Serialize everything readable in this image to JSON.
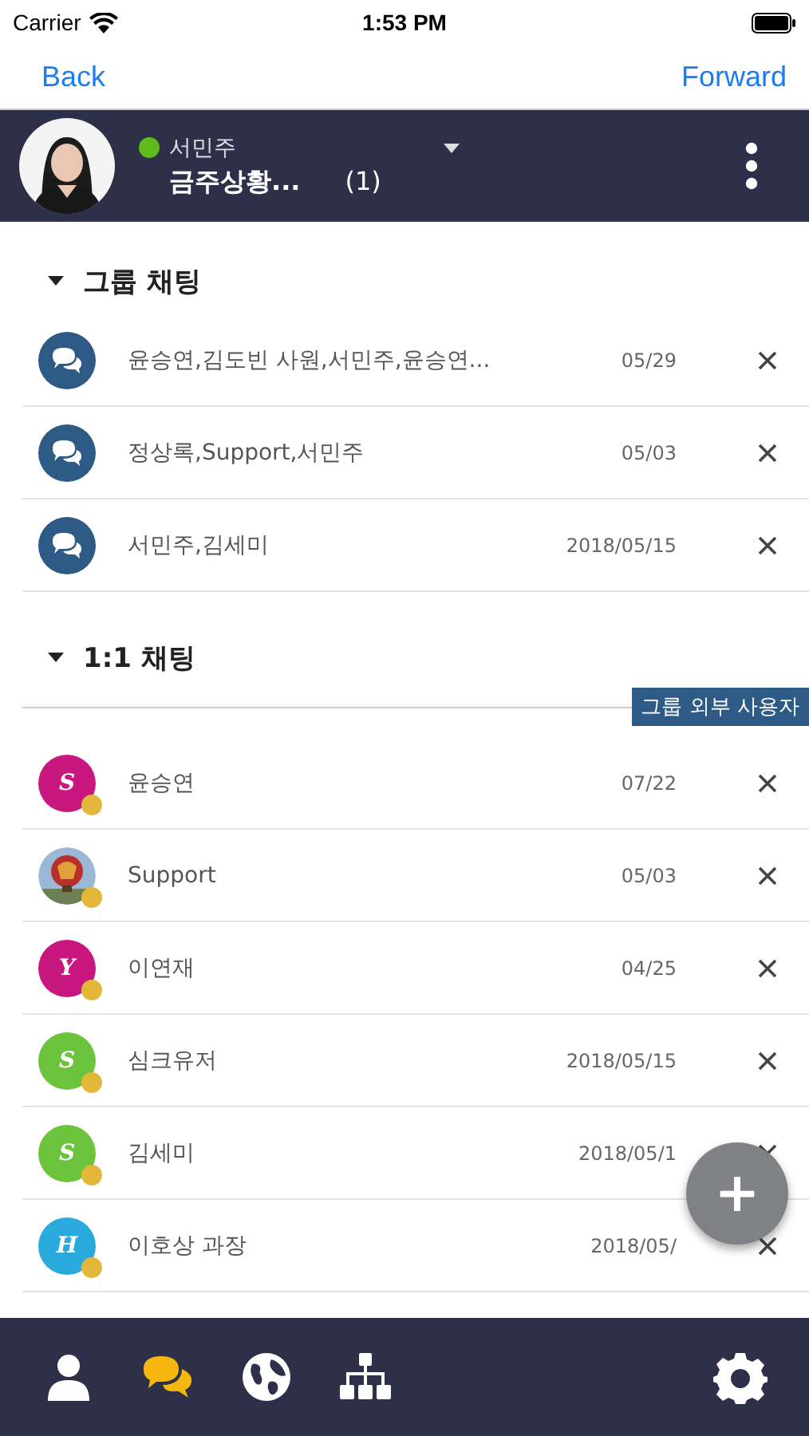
{
  "status_bar": {
    "carrier": "Carrier",
    "time": "1:53 PM"
  },
  "nav": {
    "back": "Back",
    "forward": "Forward"
  },
  "header": {
    "user_name": "서민주",
    "online": true,
    "room_title": "금주상황...",
    "count": "(1)"
  },
  "group_section": {
    "title": "그룹 채팅",
    "expanded": true,
    "rows": [
      {
        "title": "윤승연,김도빈 사원,서민주,윤승연...",
        "date": "05/29"
      },
      {
        "title": "정상록,Support,서민주",
        "date": "05/03"
      },
      {
        "title": "서민주,김세미",
        "date": "2018/05/15"
      }
    ]
  },
  "direct_section": {
    "title": "1:1 채팅",
    "expanded": true,
    "tag": "그룹 외부 사용자",
    "rows": [
      {
        "kind": "letter",
        "letter": "S",
        "color": "#c8177e",
        "name": "윤승연",
        "date": "07/22"
      },
      {
        "kind": "picture",
        "name": "Support",
        "date": "05/03"
      },
      {
        "kind": "letter",
        "letter": "Y",
        "color": "#c8177e",
        "name": "이연재",
        "date": "04/25"
      },
      {
        "kind": "letter",
        "letter": "S",
        "color": "#6cc33c",
        "name": "심크유저",
        "date": "2018/05/15"
      },
      {
        "kind": "letter",
        "letter": "S",
        "color": "#6cc33c",
        "name": "김세미",
        "date": "2018/05/1"
      },
      {
        "kind": "letter",
        "letter": "H",
        "color": "#2aa9dc",
        "name": "이호상 과장",
        "date": "2018/05/"
      }
    ]
  },
  "fab": {
    "symbol": "+"
  },
  "tabbar": [
    {
      "selected": false
    },
    {
      "selected": true
    },
    {
      "selected": false
    },
    {
      "selected": false
    },
    {
      "selected": false
    }
  ]
}
